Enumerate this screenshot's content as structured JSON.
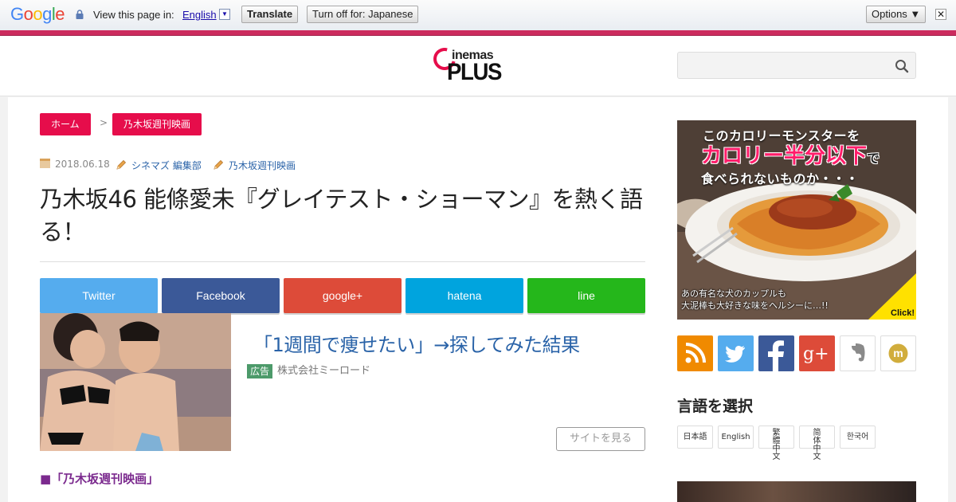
{
  "translate_bar": {
    "brand": "Google",
    "view_text": "View this page in:",
    "language": "English",
    "language_arrow": "▼",
    "translate_button": "Translate",
    "turn_off_button": "Turn off for: Japanese",
    "options_button": "Options ▼",
    "close_symbol": "✕"
  },
  "header": {
    "logo_small": "inemas",
    "logo_big": "PLUS",
    "search": {
      "value": "",
      "placeholder": ""
    }
  },
  "breadcrumb": {
    "home": "ホーム",
    "separator": ">",
    "category": "乃木坂週刊映画"
  },
  "article": {
    "date": "2018.06.18",
    "author": "シネマズ 編集部",
    "tag": "乃木坂週刊映画",
    "title": "乃木坂46 能條愛未『グレイテスト・ショーマン』を熱く語る！",
    "share": [
      {
        "label": "Twitter",
        "color": "#55acee"
      },
      {
        "label": "Facebook",
        "color": "#3b5998"
      },
      {
        "label": "google+",
        "color": "#dd4b39"
      },
      {
        "label": "hatena",
        "color": "#00a4de"
      },
      {
        "label": "line",
        "color": "#25b71b"
      }
    ],
    "ad": {
      "title": "「1週間で痩せたい」→探してみた結果",
      "badge": "広告",
      "sponsor": "株式会社ミーロード",
      "button": "サイトを見る"
    },
    "section_heading": "■「乃木坂週刊映画」"
  },
  "sidebar": {
    "banner": {
      "line1": "このカロリーモンスターを",
      "line2_main": "カロリー半分以下",
      "line2_suffix": "で",
      "line3": "食べられないものか・・・",
      "line4": "あの有名な犬のカップルも",
      "line5": "大泥棒も大好きな味をヘルシーに…!!",
      "click": "Click!"
    },
    "social_icons": [
      "rss-icon",
      "twitter-icon",
      "facebook-icon",
      "google-plus-icon",
      "evernote-icon",
      "mixi-icon"
    ],
    "language_heading": "言語を選択",
    "languages": [
      "日本語",
      "English",
      "繁體中文",
      "简体中文",
      "한국어"
    ]
  },
  "colors": {
    "accent": "#e60d4b",
    "translate_accent": "#cc2b5e",
    "link": "#2a63a8",
    "section_heading": "#7b2a8e"
  }
}
